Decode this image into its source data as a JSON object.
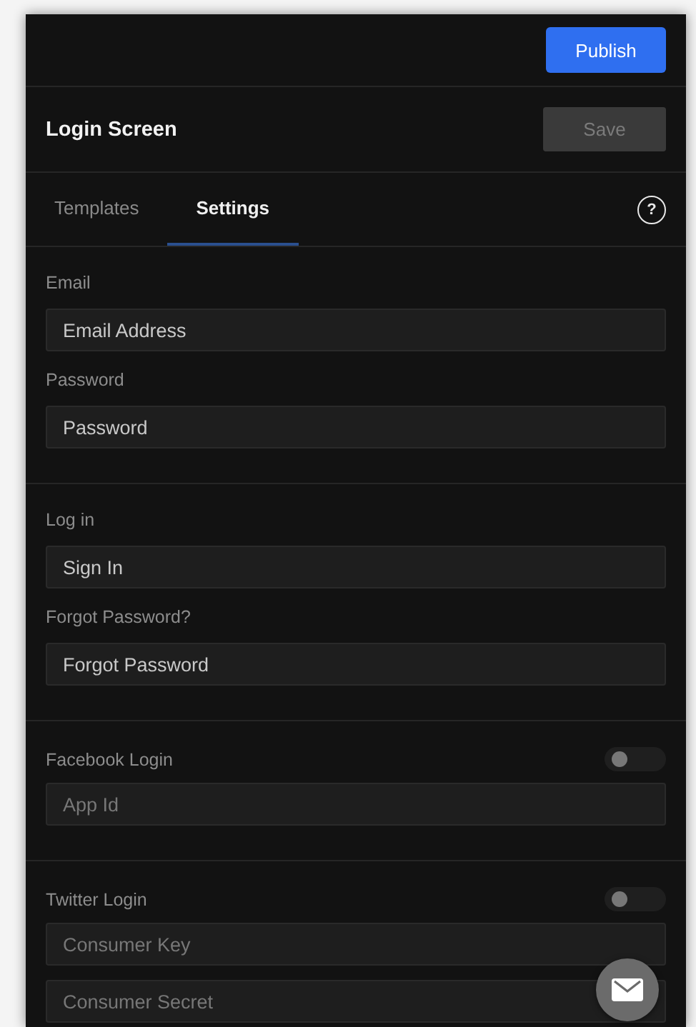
{
  "top_bar": {
    "publish_button": "Publish"
  },
  "header": {
    "title": "Login Screen",
    "save_button": {
      "label": "Save",
      "disabled": true
    }
  },
  "tabs": [
    {
      "label": "Templates",
      "selected": false
    },
    {
      "label": "Settings",
      "selected": true
    }
  ],
  "help_icon": "?",
  "sections": [
    {
      "fields": [
        {
          "label": "Email",
          "value": "Email Address"
        },
        {
          "label": "Password",
          "value": "Password"
        }
      ]
    },
    {
      "fields": [
        {
          "label": "Log in",
          "value": "Sign In"
        },
        {
          "label": "Forgot Password?",
          "value": "Forgot Password"
        }
      ]
    },
    {
      "heading": "Facebook Login",
      "toggle_on": false,
      "fields": [
        {
          "placeholder": "App Id"
        }
      ]
    },
    {
      "heading": "Twitter Login",
      "toggle_on": false,
      "fields": [
        {
          "placeholder": "Consumer Key"
        },
        {
          "placeholder": "Consumer Secret"
        }
      ]
    }
  ]
}
